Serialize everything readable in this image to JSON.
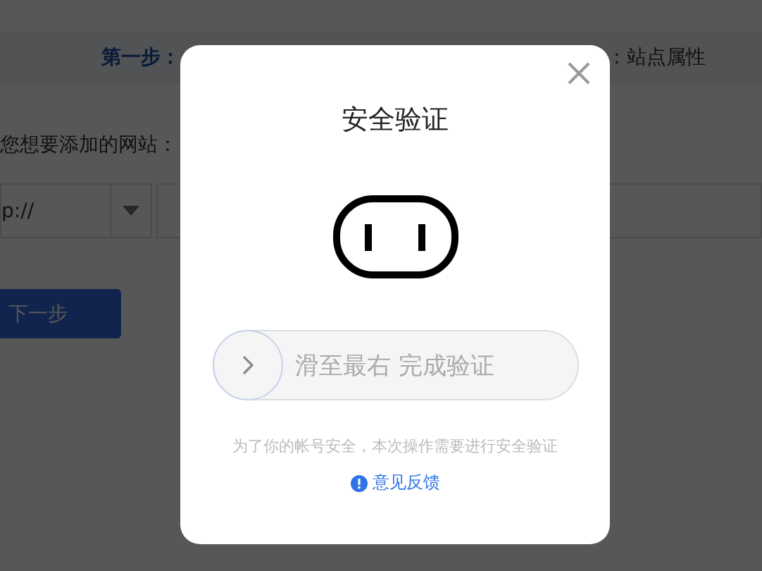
{
  "page": {
    "steps": [
      {
        "label": "第一步：",
        "selected": true
      },
      {
        "label": "：站点属性",
        "selected": false
      }
    ],
    "site_label": "您想要添加的网站：",
    "protocol_select": {
      "value": "p://"
    },
    "next_button": "下一步"
  },
  "dialog": {
    "title": "安全验证",
    "slider": {
      "label": "滑至最右 完成验证",
      "level": 0
    },
    "note": "为了你的帐号安全，本次操作需要进行安全验证",
    "feedback_link": "意见反馈"
  }
}
